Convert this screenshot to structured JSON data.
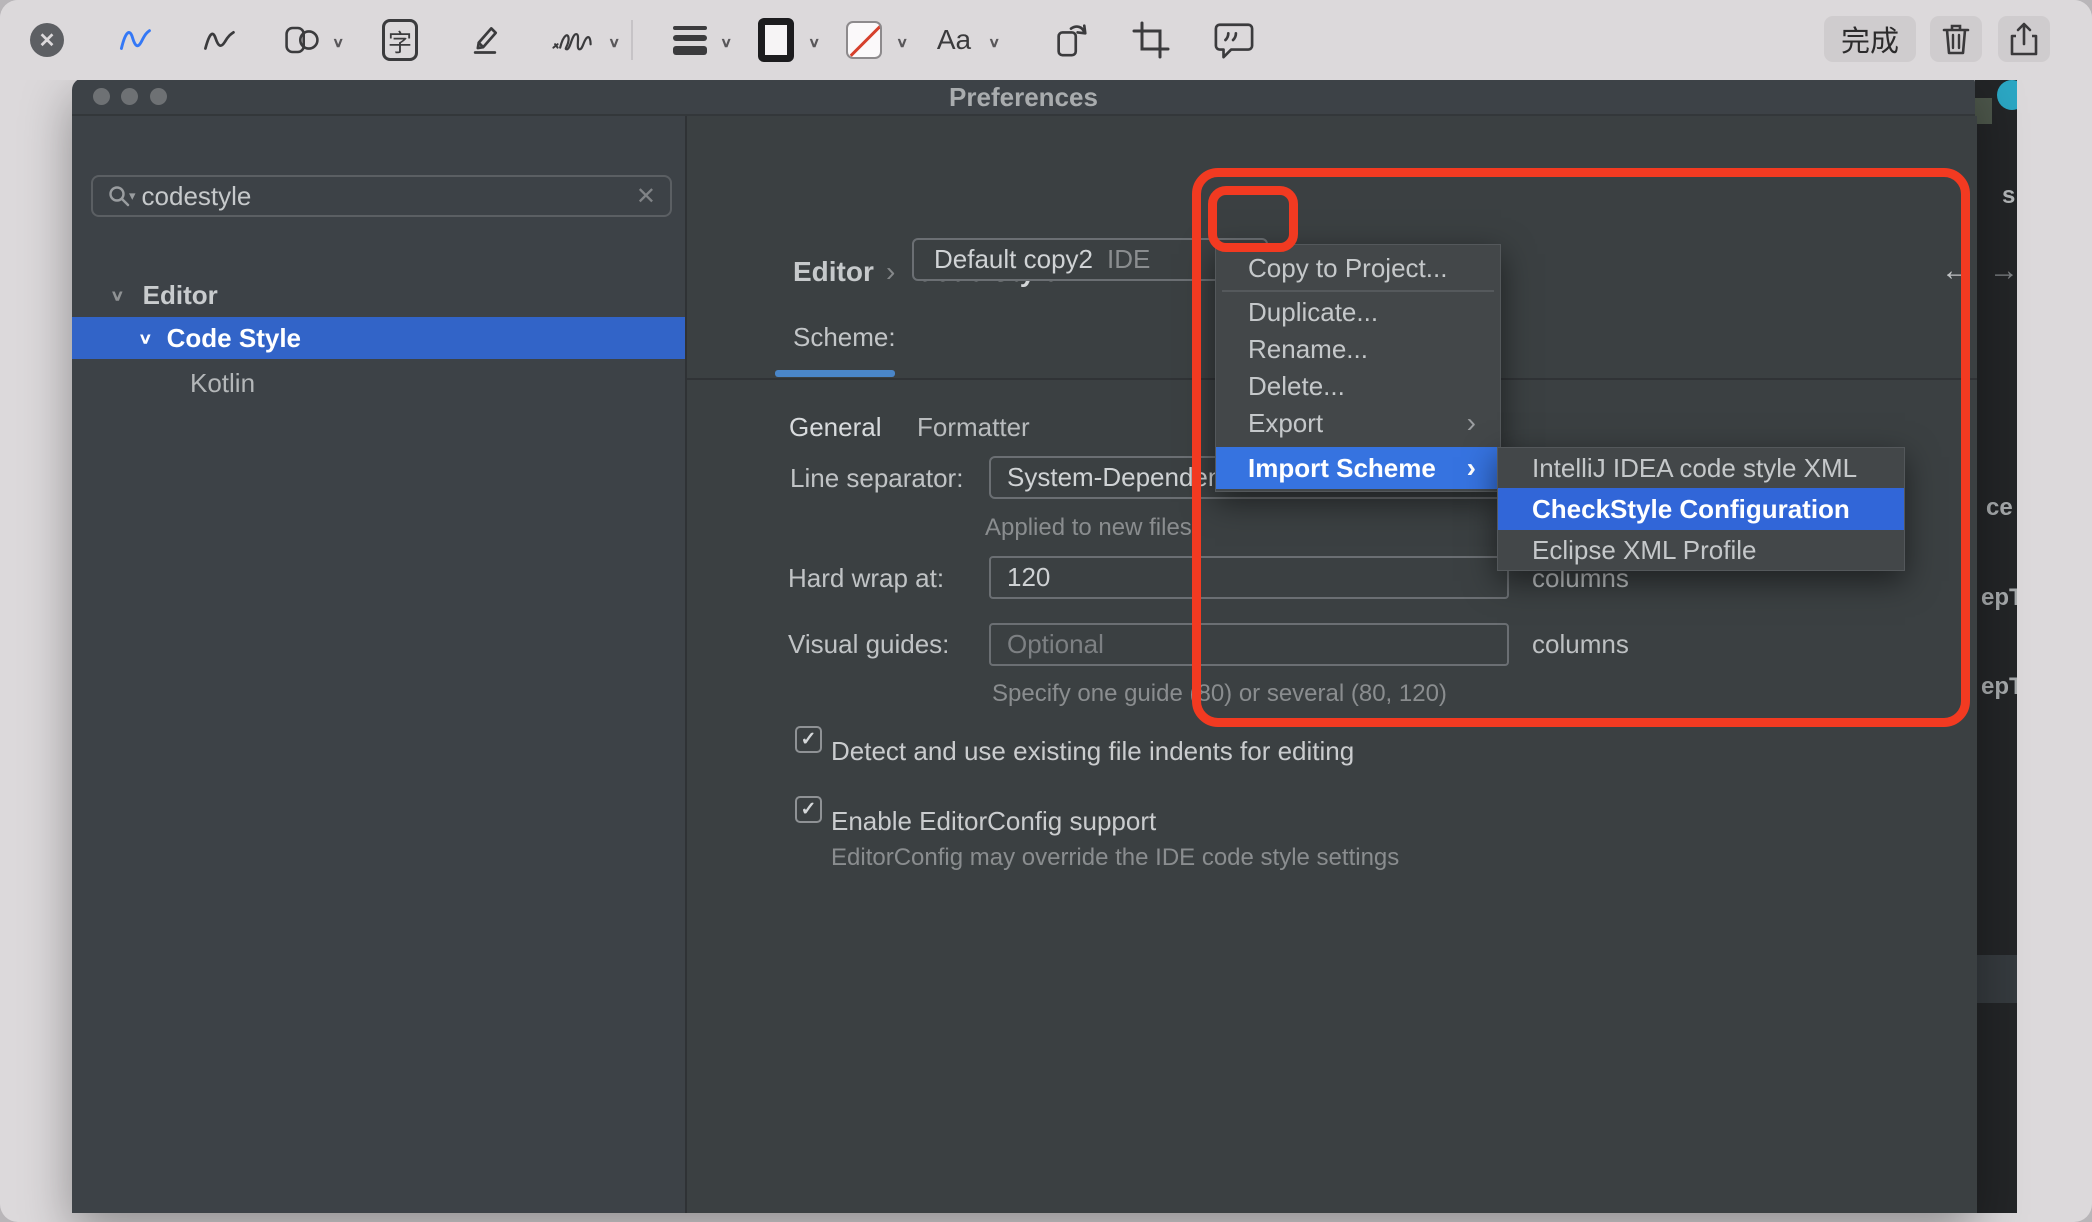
{
  "markup_toolbar": {
    "done_label": "完成",
    "text_style_label": "Aa",
    "text_tool_glyph": "字"
  },
  "icons": {
    "close": "✕",
    "clear": "✕",
    "chevron_down": "∨",
    "chevron_right": "›",
    "dropdown_arrow": "▾",
    "search_dropdown_arrow": "▾",
    "back_arrow": "←",
    "forward_arrow": "→",
    "gear": "⚙",
    "check": "✓",
    "breadcrumb_separator": "›"
  },
  "window": {
    "title": "Preferences",
    "search": {
      "value": "codestyle"
    },
    "sidebar_tree": [
      {
        "label": "Editor"
      },
      {
        "label": "Code Style",
        "selected": true
      },
      {
        "label": "Kotlin"
      }
    ],
    "breadcrumb": {
      "level1": "Editor",
      "level2": "Code Style"
    },
    "scheme_row": {
      "label": "Scheme:",
      "value": "Default copy2",
      "badge": "IDE"
    },
    "tabs": [
      {
        "label": "General",
        "active": true
      },
      {
        "label": "Formatter",
        "active": false
      }
    ],
    "form": {
      "line_separator_label": "Line separator:",
      "line_separator_value": "System-Dependent",
      "line_separator_hint": "Applied to new files",
      "hard_wrap_label": "Hard wrap at:",
      "hard_wrap_value": "120",
      "hard_wrap_suffix": "columns",
      "visual_guides_label": "Visual guides:",
      "visual_guides_placeholder": "Optional",
      "visual_guides_suffix": "columns",
      "visual_guides_hint": "Specify one guide (80) or several (80, 120)",
      "checkbox1_label": "Detect and use existing file indents for editing",
      "checkbox2_label": "Enable EditorConfig support",
      "editorconfig_hint": "EditorConfig may override the IDE code style settings"
    },
    "scheme_menu": {
      "items": [
        {
          "label": "Copy to Project..."
        },
        {
          "label": "Duplicate..."
        },
        {
          "label": "Rename..."
        },
        {
          "label": "Delete..."
        },
        {
          "label": "Export",
          "has_submenu": true
        },
        {
          "label": "Import Scheme",
          "has_submenu": true,
          "highlighted": true
        }
      ]
    },
    "import_submenu": {
      "items": [
        {
          "label": "IntelliJ IDEA code style XML"
        },
        {
          "label": "CheckStyle Configuration",
          "highlighted": true
        },
        {
          "label": "Eclipse XML Profile"
        }
      ]
    },
    "background_fragments": {
      "f1": "s",
      "f2": "ce",
      "f3": "epT",
      "f4": "epT"
    }
  },
  "colors": {
    "annotation_red": "#f23a21",
    "tree_selection_blue": "#3264c8",
    "menu_highlight_blue": "#3673e0",
    "submenu_highlight_blue": "#3166d8",
    "tab_underline_blue": "#4a86c9",
    "sketch_tool_blue": "#3478f6"
  }
}
